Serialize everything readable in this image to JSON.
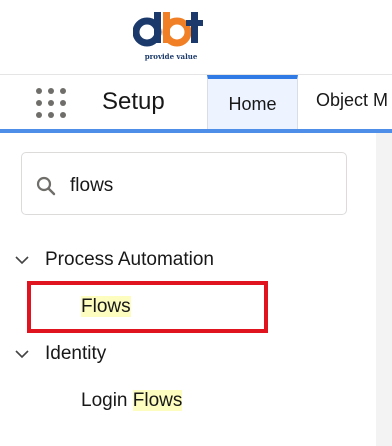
{
  "logo": {
    "tagline": "provide value",
    "colors": {
      "blue": "#1b3a6b",
      "orange": "#f07f25"
    }
  },
  "nav": {
    "app_launcher_icon": "grid-icon",
    "app_name": "Setup",
    "tabs": [
      {
        "label": "Home",
        "active": true
      },
      {
        "label": "Object M"
      }
    ]
  },
  "sidebar": {
    "search": {
      "icon": "search-icon",
      "value": "flows"
    },
    "tree": [
      {
        "heading": "Process Automation",
        "expanded": true,
        "items": [
          {
            "label": "Flows",
            "highlight": "Flows"
          }
        ]
      },
      {
        "heading": "Identity",
        "expanded": true,
        "items": [
          {
            "prefix": "Login ",
            "highlight": "Flows"
          }
        ]
      }
    ]
  },
  "colors": {
    "accent": "#2f7ae5",
    "highlight_box": "#e0141e",
    "match_highlight": "#fdfdc0"
  }
}
